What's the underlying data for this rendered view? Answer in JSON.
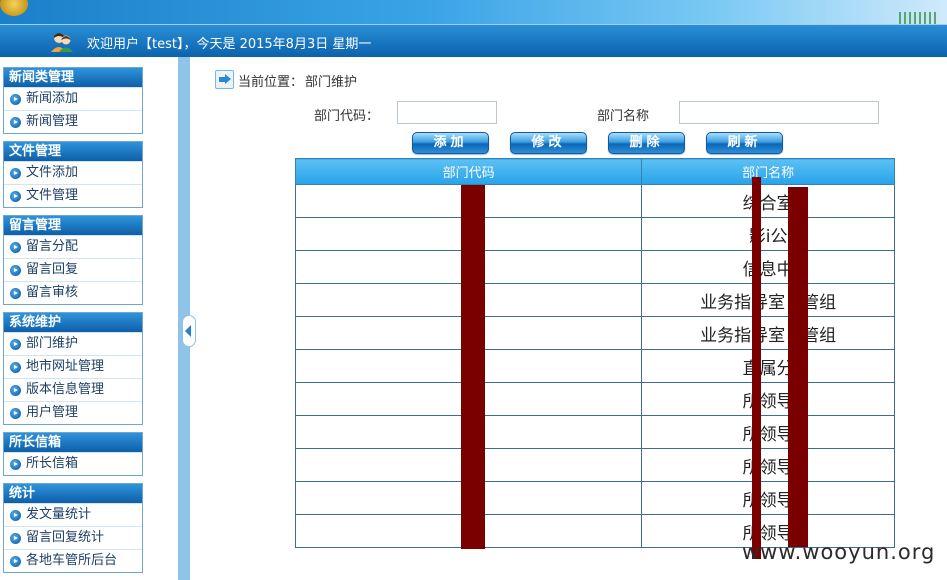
{
  "banner": {
    "title": ""
  },
  "welcome": {
    "text": "欢迎用户【test】，今天是 2015年8月3日 星期一"
  },
  "sidebar": {
    "groups": [
      {
        "title": "新闻类管理",
        "items": [
          "新闻添加",
          "新闻管理"
        ]
      },
      {
        "title": "文件管理",
        "items": [
          "文件添加",
          "文件管理"
        ]
      },
      {
        "title": "留言管理",
        "items": [
          "留言分配",
          "留言回复",
          "留言审核"
        ]
      },
      {
        "title": "系统维护",
        "items": [
          "部门维护",
          "地市网址管理",
          "版本信息管理",
          "用户管理"
        ]
      },
      {
        "title": "所长信箱",
        "items": [
          "所长信箱"
        ]
      },
      {
        "title": "统计",
        "items": [
          "发文量统计",
          "留言回复统计",
          "各地车管所后台"
        ]
      }
    ]
  },
  "breadcrumb": {
    "label": "当前位置：",
    "current": "部门维护"
  },
  "form": {
    "code_label": "部门代码：",
    "code_value": "",
    "name_label": "部门名称",
    "name_value": ""
  },
  "buttons": {
    "add": "添加",
    "edit": "修改",
    "delete": "删除",
    "refresh": "刷新"
  },
  "table": {
    "headers": [
      "部门代码",
      "部门名称"
    ],
    "rows": [
      {
        "code": "",
        "name": "综合室"
      },
      {
        "code": "",
        "name": "影i公"
      },
      {
        "code": "",
        "name": "信息中"
      },
      {
        "code": "",
        "name": "业务指导室　管组"
      },
      {
        "code": "",
        "name": "业务指导室　管组"
      },
      {
        "code": "",
        "name": "直属分"
      },
      {
        "code": "",
        "name": "所领导"
      },
      {
        "code": "",
        "name": "所领导"
      },
      {
        "code": "",
        "name": "所领导"
      },
      {
        "code": "",
        "name": "所领导"
      },
      {
        "code": "",
        "name": "所领导"
      }
    ]
  },
  "watermark": "www.wooyun.org",
  "colors": {
    "header_blue": "#0b62ad",
    "table_header": "#27a3ea",
    "redaction": "#7a0000"
  }
}
